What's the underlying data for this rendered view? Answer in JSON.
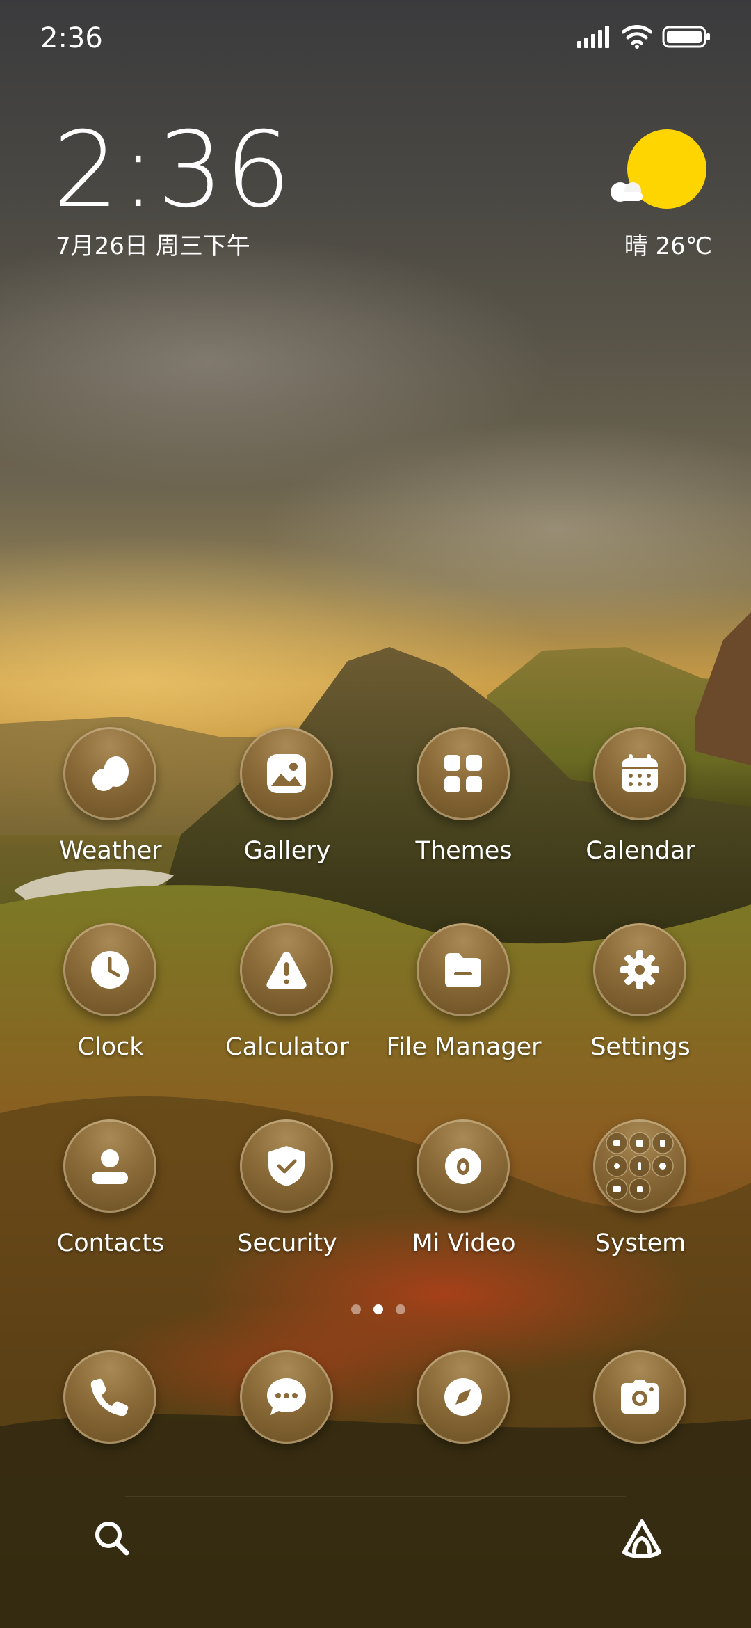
{
  "status_bar": {
    "time": "2:36"
  },
  "clock_widget": {
    "time": "2:36",
    "date": "7月26日 周三下午"
  },
  "weather_widget": {
    "text": "晴 26℃",
    "sun_color": "#ffd500"
  },
  "apps": [
    {
      "label": "Weather",
      "icon": "weather-drop-icon"
    },
    {
      "label": "Gallery",
      "icon": "gallery-icon"
    },
    {
      "label": "Themes",
      "icon": "themes-grid-icon"
    },
    {
      "label": "Calendar",
      "icon": "calendar-icon"
    },
    {
      "label": "Clock",
      "icon": "clock-icon"
    },
    {
      "label": "Calculator",
      "icon": "warning-triangle-icon"
    },
    {
      "label": "File Manager",
      "icon": "folder-icon"
    },
    {
      "label": "Settings",
      "icon": "gear-icon"
    },
    {
      "label": "Contacts",
      "icon": "person-icon"
    },
    {
      "label": "Security",
      "icon": "shield-check-icon"
    },
    {
      "label": "Mi Video",
      "icon": "video-play-icon"
    },
    {
      "label": "System",
      "icon": "folder-grid-icon"
    }
  ],
  "dock": [
    {
      "icon": "phone-icon"
    },
    {
      "icon": "message-bubble-icon"
    },
    {
      "icon": "compass-icon"
    },
    {
      "icon": "camera-icon"
    }
  ],
  "page_indicator": {
    "pages": 3,
    "active_index": 1
  },
  "bottom_bar": {
    "left_icon": "search-icon",
    "right_icon": "assistant-icon"
  },
  "colors": {
    "icon_gold": "#8a6a38",
    "text": "#ffffff"
  }
}
